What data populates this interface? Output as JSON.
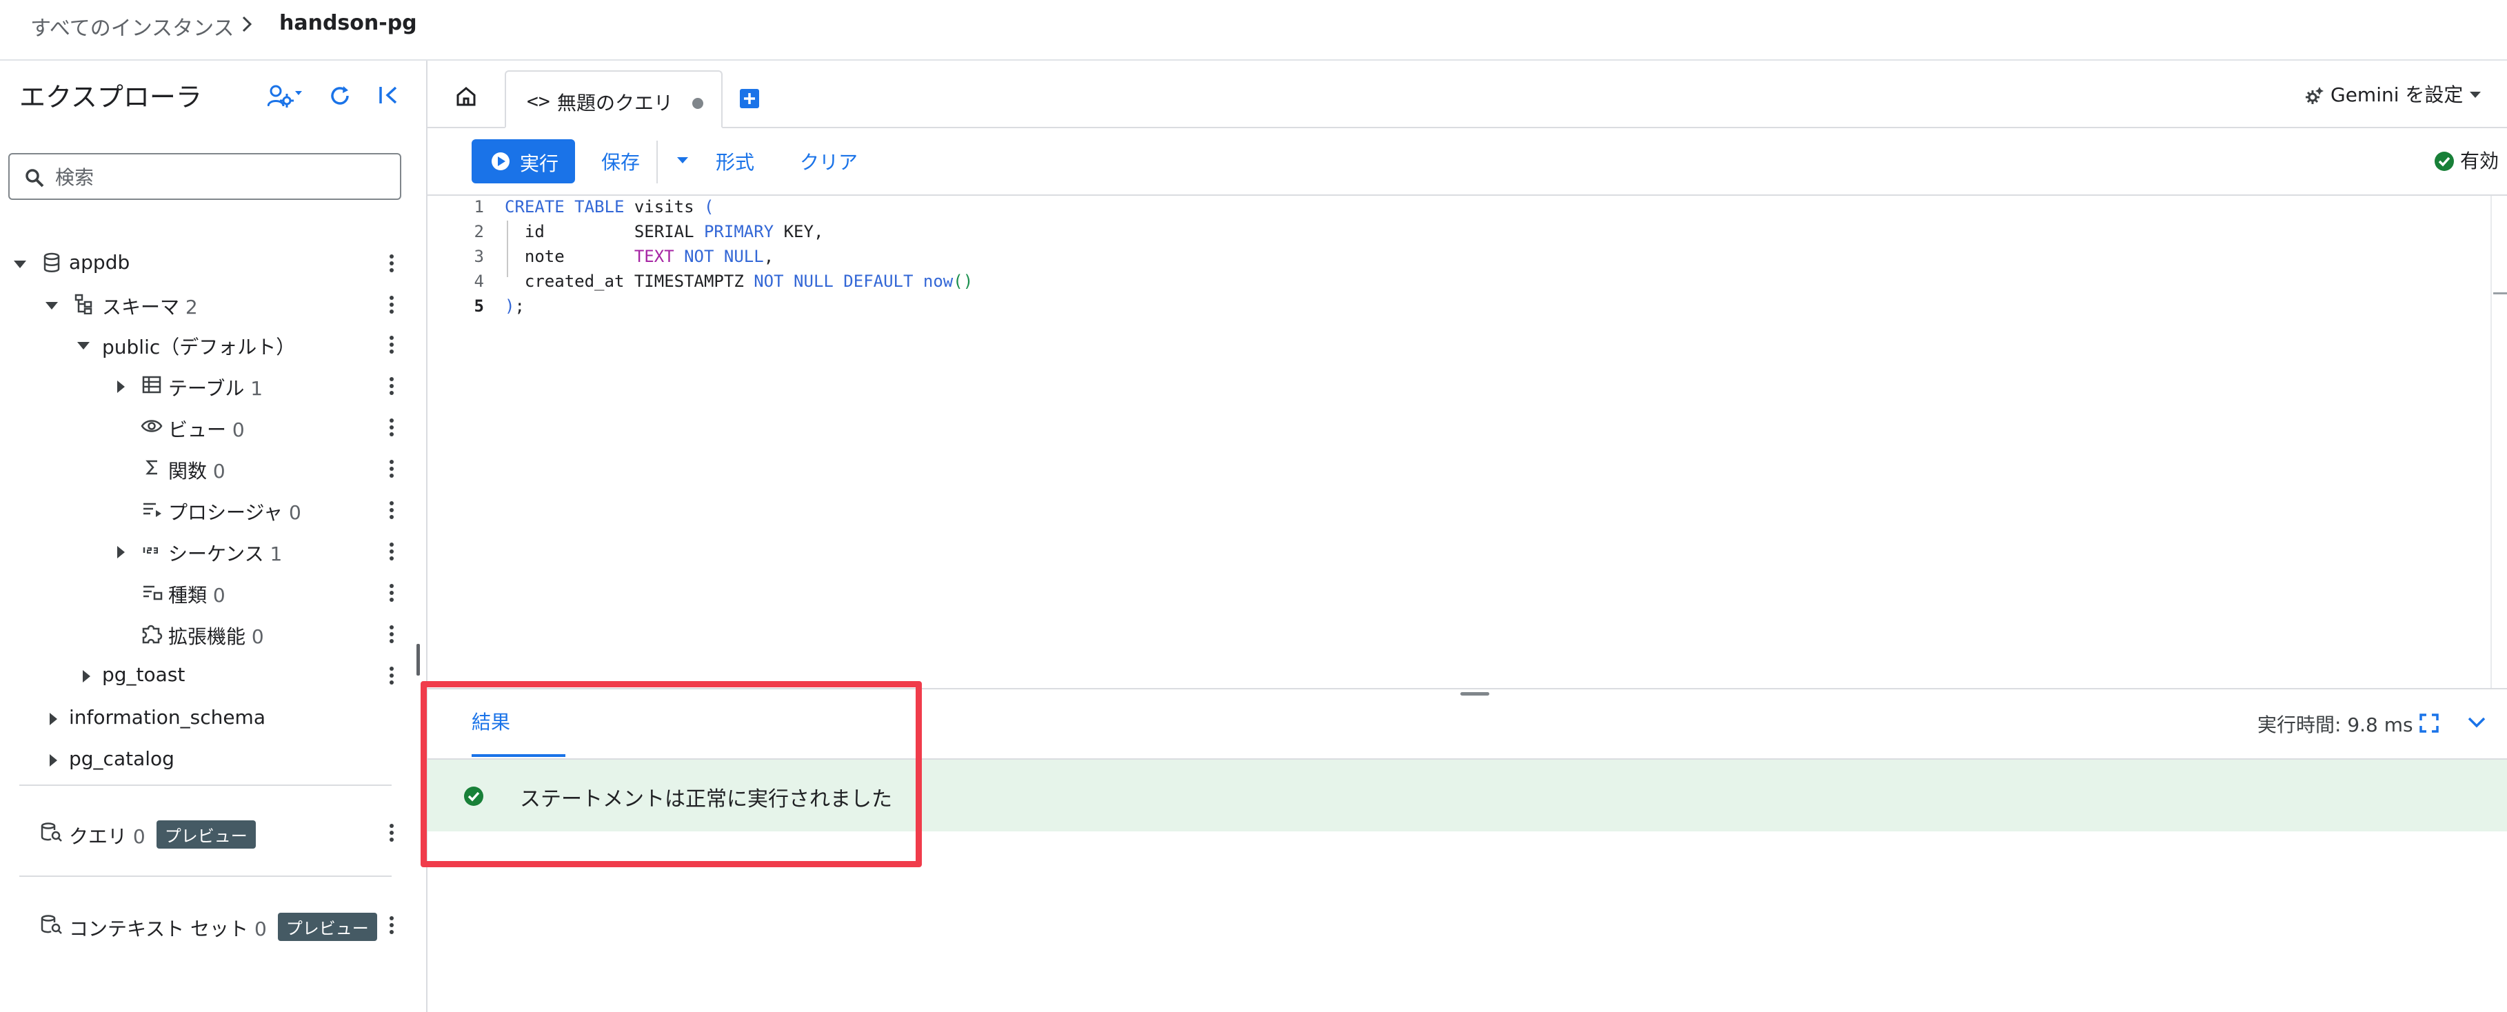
{
  "breadcrumb": {
    "root": "すべてのインスタンス",
    "current": "handson-pg"
  },
  "sidebar": {
    "title": "エクスプローラ",
    "search": {
      "placeholder": "検索",
      "value": ""
    },
    "tree": [
      {
        "label": "appdb",
        "count": "",
        "icon": "database-icon",
        "expanded": true
      },
      {
        "label": "スキーマ",
        "count": "2",
        "icon": "schema-icon",
        "expanded": true
      },
      {
        "label": "public（デフォルト）",
        "count": "",
        "icon": "",
        "expanded": true
      },
      {
        "label": "テーブル",
        "count": "1",
        "icon": "table-icon",
        "expanded": false
      },
      {
        "label": "ビュー",
        "count": "0",
        "icon": "eye-icon"
      },
      {
        "label": "関数",
        "count": "0",
        "icon": "sigma-icon"
      },
      {
        "label": "プロシージャ",
        "count": "0",
        "icon": "procedure-icon"
      },
      {
        "label": "シーケンス",
        "count": "1",
        "icon": "sequence-icon",
        "expanded": false
      },
      {
        "label": "種類",
        "count": "0",
        "icon": "type-icon"
      },
      {
        "label": "拡張機能",
        "count": "0",
        "icon": "extension-icon"
      },
      {
        "label": "pg_toast",
        "count": "",
        "icon": "",
        "expanded": false
      },
      {
        "label": "information_schema",
        "count": "",
        "icon": "",
        "expanded": false
      },
      {
        "label": "pg_catalog",
        "count": "",
        "icon": "",
        "expanded": false
      }
    ],
    "queries": {
      "label": "クエリ",
      "count": "0",
      "badge": "プレビュー"
    },
    "context_sets": {
      "label": "コンテキスト セット",
      "count": "0",
      "badge": "プレビュー"
    }
  },
  "tabs": [
    {
      "code_glyph": "<>",
      "label": "無題のクエリ",
      "unsaved": true
    }
  ],
  "gemini": {
    "label": "Gemini を設定"
  },
  "toolbar": {
    "run": "実行",
    "save": "保存",
    "format": "形式",
    "clear": "クリア",
    "status": "有効"
  },
  "editor": {
    "line_numbers": [
      "1",
      "2",
      "3",
      "4",
      "5"
    ],
    "current_line": 5,
    "code": [
      "CREATE TABLE visits (",
      "  id         SERIAL PRIMARY KEY,",
      "  note       TEXT NOT NULL,",
      "  created_at TIMESTAMPTZ NOT NULL DEFAULT now()",
      ");"
    ]
  },
  "results": {
    "tab": "結果",
    "exec_time": "実行時間: 9.8 ms",
    "message": "ステートメントは正常に実行されました"
  },
  "colors": {
    "accent": "#1a73e8",
    "success": "#188038",
    "success_bg": "#e6f4ea",
    "highlight": "#f03c4b",
    "keyword": "#3367d6",
    "type_keyword": "#a626a4"
  }
}
